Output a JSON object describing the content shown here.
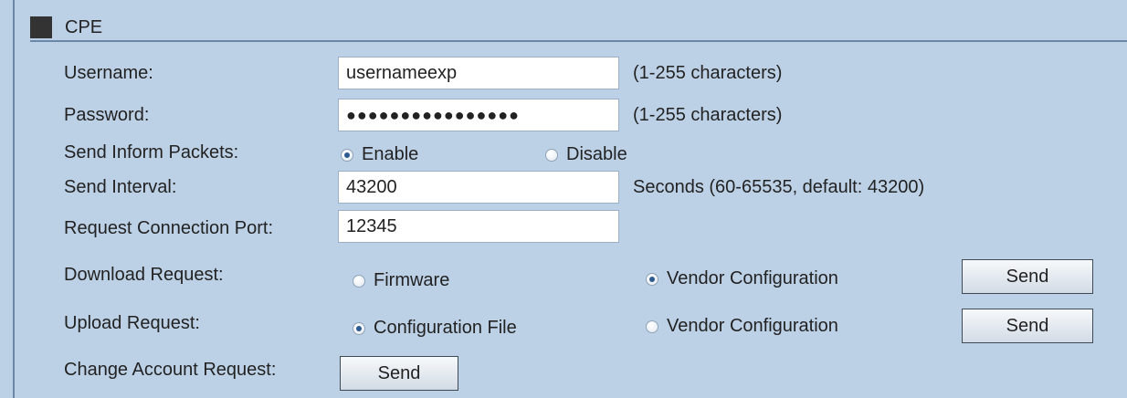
{
  "section": {
    "title": "CPE"
  },
  "fields": {
    "username": {
      "label": "Username:",
      "value": "usernameexp",
      "hint": "(1-255 characters)"
    },
    "password": {
      "label": "Password:",
      "value": "●●●●●●●●●●●●●●●●",
      "hint": "(1-255 characters)"
    },
    "send_inform": {
      "label": "Send Inform Packets:",
      "options": [
        "Enable",
        "Disable"
      ],
      "selected": "Enable"
    },
    "send_interval": {
      "label": "Send Interval:",
      "value": "43200",
      "hint": "Seconds (60-65535, default: 43200)"
    },
    "request_port": {
      "label": "Request Connection Port:",
      "value": "12345"
    }
  },
  "download_request": {
    "label": "Download Request:",
    "options": [
      "Firmware",
      "Vendor Configuration"
    ],
    "selected": "Vendor Configuration",
    "button": "Send"
  },
  "upload_request": {
    "label": "Upload Request:",
    "options": [
      "Configuration File",
      "Vendor Configuration"
    ],
    "selected": "Configuration File",
    "button": "Send"
  },
  "change_account": {
    "label": "Change Account Request:",
    "button": "Send"
  }
}
